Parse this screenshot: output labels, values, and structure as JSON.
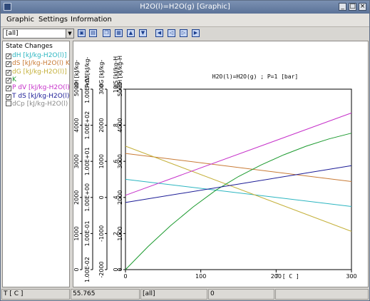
{
  "window": {
    "title": "H2O(l)=H2O(g) [Graphic]"
  },
  "menu": [
    "Graphic",
    "Settings",
    "Information"
  ],
  "toolbar": {
    "selector_value": "[all]"
  },
  "panel": {
    "title": "State Changes",
    "items": [
      {
        "label": "dH [kJ/kg-H2O(l)]",
        "checked": true,
        "color": "#2bb5c0"
      },
      {
        "label": "dS [kJ/kg-H2O(l) K",
        "checked": true,
        "color": "#c87a35"
      },
      {
        "label": "dG [kJ/kg-H2O(l)]",
        "checked": true,
        "color": "#c4b03a"
      },
      {
        "label": "K",
        "checked": true,
        "color": "#1b9a2e"
      },
      {
        "label": "P dV [kJ/kg-H2O(l)",
        "checked": true,
        "color": "#c52fc9"
      },
      {
        "label": "T dS [kJ/kg-H2O(l)",
        "checked": true,
        "color": "#1b1b96"
      },
      {
        "label": "dCp [kJ/kg-H2O(l)",
        "checked": false,
        "color": "#8a8a8a"
      }
    ]
  },
  "chart_data": {
    "type": "line",
    "title": "H2O(l)=H2O(g) ; P=1 [bar]",
    "xlabel": "T [ C ]",
    "xlim": [
      0,
      300
    ],
    "x_ticks": [
      "0",
      "100",
      "200",
      "300"
    ],
    "axes": [
      {
        "label": "dH [kJ/kg-",
        "ticks": [
          "0",
          "1000",
          "2000",
          "3000",
          "4000",
          "5000"
        ]
      },
      {
        "label": "PdV [kJ/kg-",
        "ticks": [
          "1.00E-02",
          "1.00E-01",
          "1.00E+00",
          "1.00E+01",
          "1.00E+02",
          "1.00E+03"
        ]
      },
      {
        "label": "dG [kJ/kg-",
        "ticks": [
          "-2000",
          "-1000",
          "0",
          "1000",
          "2000",
          "300"
        ]
      },
      {
        "label": "dS [kJ/kg-H",
        "ticks": [
          "0",
          "2",
          "4",
          "6",
          "8",
          "10"
        ]
      },
      {
        "label": "dH [kJ/kg-H",
        "ticks": [
          "0",
          "1000",
          "2000",
          "3000",
          "4000",
          "5000"
        ]
      }
    ],
    "ylim_primary": [
      0,
      5000
    ],
    "series": [
      {
        "name": "dH",
        "color": "#2bb5c0",
        "x": [
          0,
          300
        ],
        "y": [
          2501,
          1749
        ]
      },
      {
        "name": "dS",
        "color": "#c87a35",
        "x": [
          0,
          300
        ],
        "y": [
          3220,
          2440
        ]
      },
      {
        "name": "dG",
        "color": "#c4b03a",
        "x": [
          0,
          300
        ],
        "y": [
          3420,
          1060
        ]
      },
      {
        "name": "K",
        "color": "#1b9a2e",
        "x": [
          0,
          30,
          60,
          90,
          120,
          150,
          180,
          210,
          240,
          270,
          300
        ],
        "y": [
          0,
          640,
          1220,
          1740,
          2200,
          2580,
          2900,
          3180,
          3420,
          3620,
          3780
        ]
      },
      {
        "name": "P dV",
        "color": "#c52fc9",
        "x": [
          0,
          300
        ],
        "y": [
          2060,
          4340
        ]
      },
      {
        "name": "T dS",
        "color": "#1b1b96",
        "x": [
          0,
          300
        ],
        "y": [
          1860,
          2880
        ]
      }
    ]
  },
  "status": {
    "axis": "T [ C ]",
    "value": "55.765",
    "selection": "[all]",
    "index": "0"
  }
}
